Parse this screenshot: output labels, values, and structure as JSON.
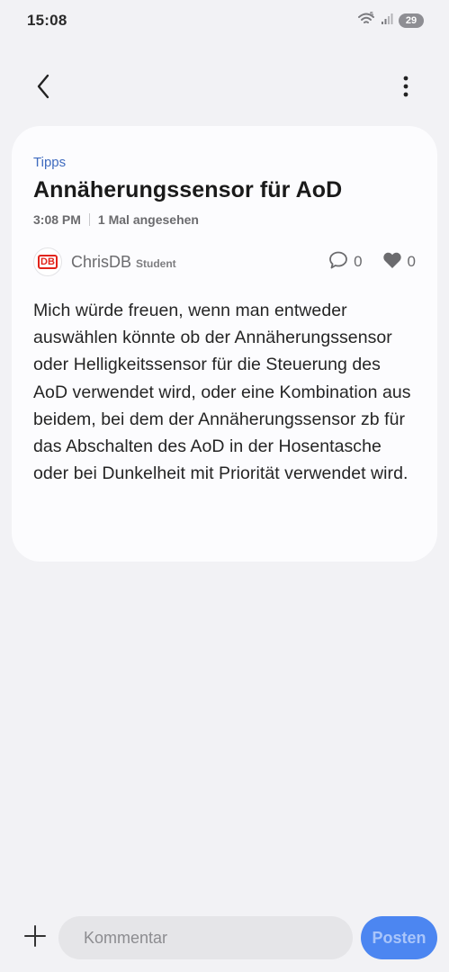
{
  "status_bar": {
    "time": "15:08",
    "battery": "29",
    "icons": [
      "wifi-icon",
      "signal-icon",
      "battery-icon"
    ]
  },
  "app_bar": {
    "back_icon": "back-chevron-icon",
    "menu_icon": "more-vertical-icon"
  },
  "post": {
    "category": "Tipps",
    "title": "Annäherungssensor für AoD",
    "time": "3:08 PM",
    "views": "1 Mal angesehen",
    "author": {
      "name": "ChrisDB",
      "role": "Student",
      "avatar_text": "DB"
    },
    "comments_count": "0",
    "likes_count": "0",
    "body": "Mich würde freuen, wenn man entweder auswählen könnte ob der Annäherungssensor oder Helligkeitssensor für die Steuerung des AoD verwendet wird, oder eine Kombination aus beidem, bei dem der Annäherungssensor zb für das Abschalten des AoD in der Hosentasche oder bei Dunkelheit mit Priorität verwendet wird."
  },
  "comment_bar": {
    "placeholder": "Kommentar",
    "submit_label": "Posten"
  },
  "colors": {
    "accent": "#4c86f1",
    "category": "#3f6bbf",
    "background": "#f2f2f5",
    "card": "#fcfcfe"
  }
}
